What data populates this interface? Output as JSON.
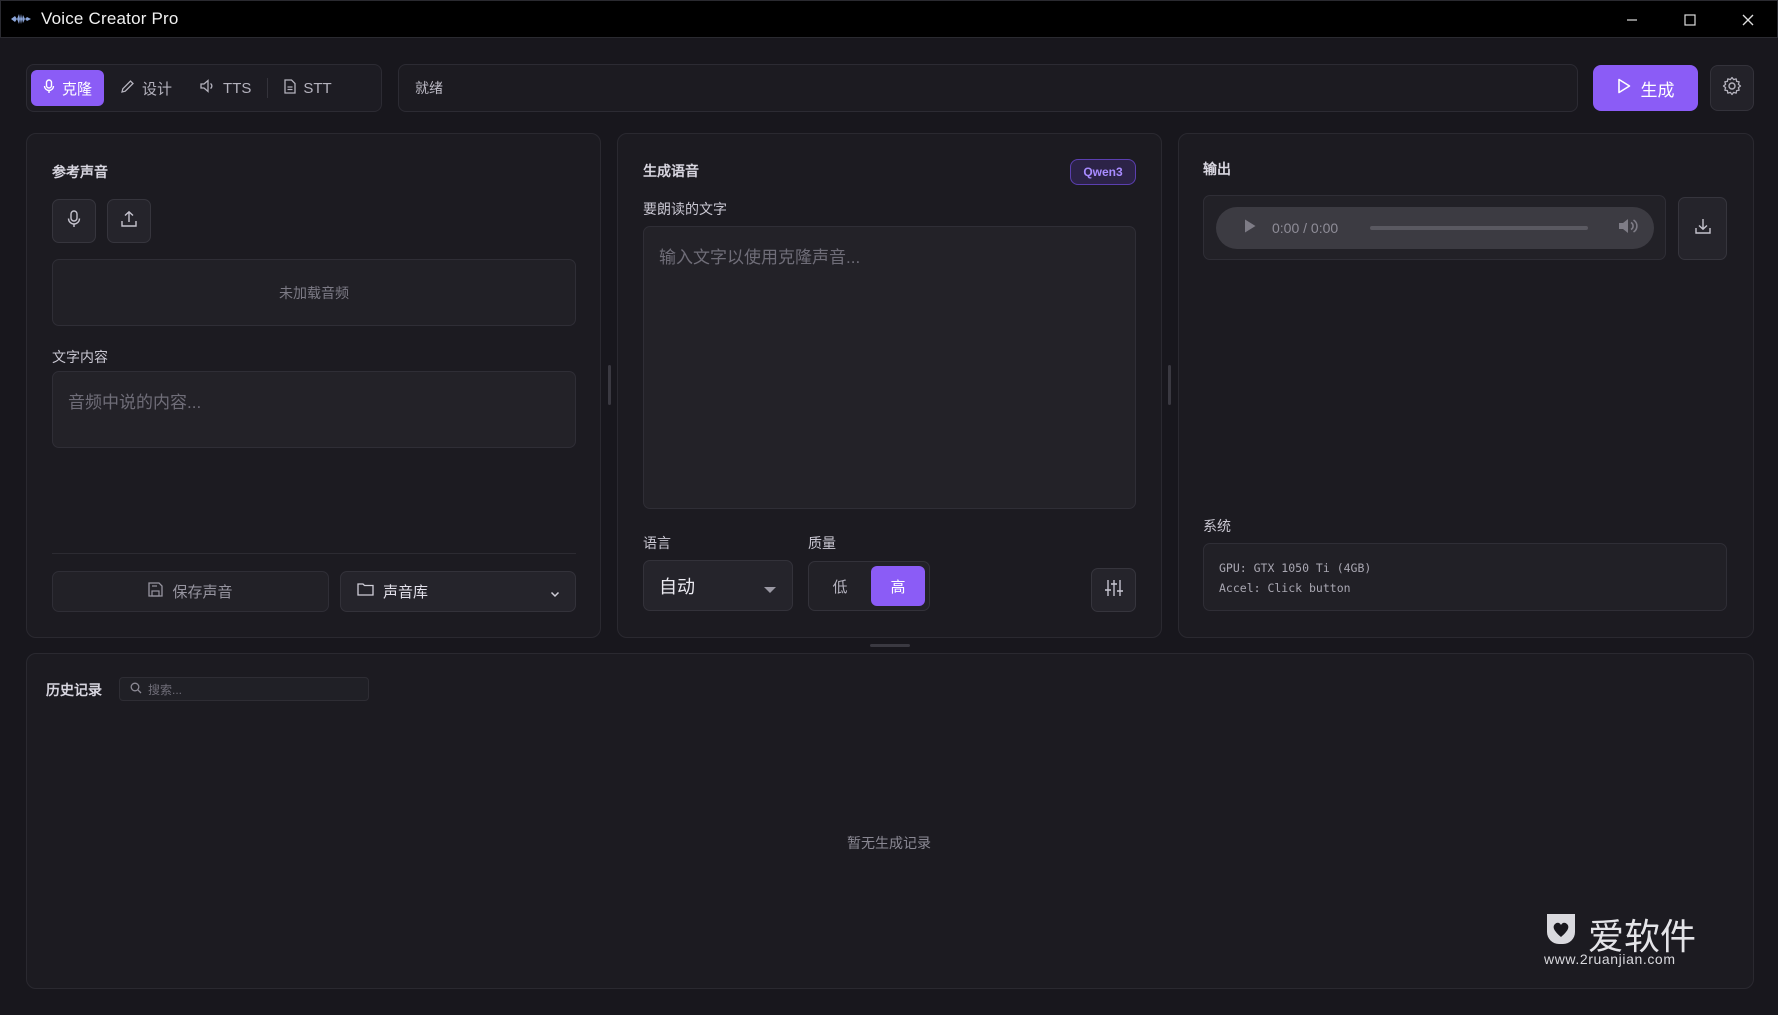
{
  "window": {
    "title": "Voice Creator Pro"
  },
  "toolbar": {
    "tabs": [
      {
        "label": "克隆",
        "icon": "mic-icon",
        "active": true
      },
      {
        "label": "设计",
        "icon": "pencil-icon",
        "active": false
      },
      {
        "label": "TTS",
        "icon": "speaker-icon",
        "active": false
      },
      {
        "label": "STT",
        "icon": "document-icon",
        "active": false
      }
    ],
    "status": "就绪",
    "generate_label": "生成"
  },
  "reference_panel": {
    "title": "参考声音",
    "no_audio_text": "未加载音频",
    "text_label": "文字内容",
    "text_placeholder": "音频中说的内容...",
    "save_label": "保存声音",
    "library_label": "声音库"
  },
  "generate_panel": {
    "title": "生成语音",
    "model_badge": "Qwen3",
    "text_label": "要朗读的文字",
    "text_placeholder": "输入文字以使用克隆声音...",
    "language_label": "语言",
    "language_value": "自动",
    "quality_label": "质量",
    "quality_options": [
      "低",
      "高"
    ],
    "quality_selected": "高"
  },
  "output_panel": {
    "title": "输出",
    "player_time": "0:00 / 0:00",
    "system_label": "系统",
    "system_lines": [
      "GPU: GTX 1050 Ti (4GB)",
      "Accel: Click button"
    ]
  },
  "history": {
    "title": "历史记录",
    "search_placeholder": "搜索...",
    "empty_text": "暂无生成记录"
  },
  "watermark": {
    "brand": "爱软件",
    "url": "www.2ruanjian.com"
  },
  "colors": {
    "accent": "#8b5cf6",
    "background": "#18171d",
    "panel": "#1c1b21"
  }
}
